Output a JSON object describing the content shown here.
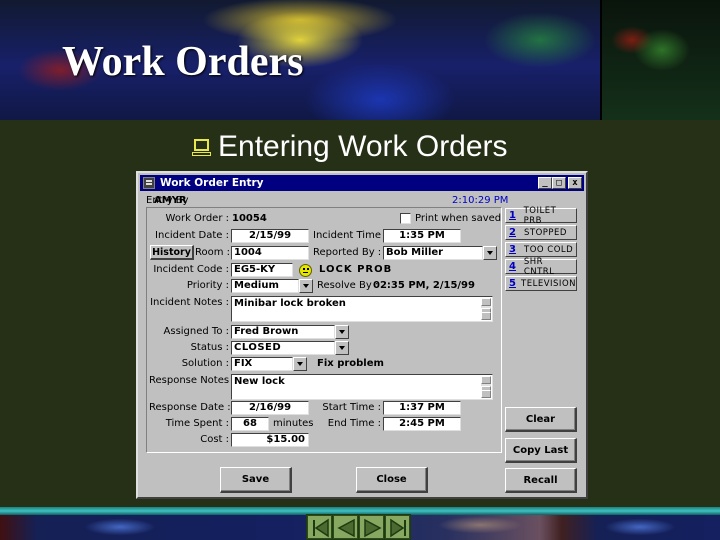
{
  "slide": {
    "title": "Work Orders",
    "bullet_icon": "computer-icon",
    "subtitle": "Entering Work Orders"
  },
  "window": {
    "title": "Work Order Entry",
    "icon": "form-icon",
    "controls": {
      "minimize": "_",
      "maximize": "□",
      "close": "x"
    },
    "entry_by_label": "Entry By",
    "entry_by_value": "AMYR",
    "clock": "2:10:29 PM"
  },
  "form": {
    "work_order": {
      "label": "Work Order :",
      "value": "10054"
    },
    "print_when_saved": {
      "label": "Print when saved",
      "checked": false
    },
    "incident_date": {
      "label": "Incident Date :",
      "value": "2/15/99"
    },
    "incident_time": {
      "label": "Incident Time :",
      "value": "1:35 PM"
    },
    "history_button": "History",
    "room": {
      "label": "Room :",
      "value": "1004"
    },
    "reported_by": {
      "label": "Reported By :",
      "value": "Bob Miller"
    },
    "incident_code": {
      "label": "Incident Code :",
      "value": "EG5-KY",
      "icon": "smiley-icon",
      "description": "LOCK PROB"
    },
    "priority": {
      "label": "Priority :",
      "value": "Medium"
    },
    "resolve_by": {
      "label": "Resolve By :",
      "value": "02:35 PM, 2/15/99"
    },
    "incident_notes": {
      "label": "Incident Notes :",
      "value": "Minibar lock broken"
    },
    "assigned_to": {
      "label": "Assigned To :",
      "value": "Fred Brown"
    },
    "status": {
      "label": "Status :",
      "value": "CLOSED"
    },
    "solution": {
      "label": "Solution :",
      "value": "FIX",
      "description": "Fix problem"
    },
    "response_notes": {
      "label": "Response Notes :",
      "value": "New lock"
    },
    "response_date": {
      "label": "Response Date :",
      "value": "2/16/99"
    },
    "start_time": {
      "label": "Start Time :",
      "value": "1:37 PM"
    },
    "time_spent": {
      "label": "Time Spent :",
      "value": "68",
      "unit": "minutes"
    },
    "end_time": {
      "label": "End Time :",
      "value": "2:45 PM"
    },
    "cost": {
      "label": "Cost :",
      "value": "$15.00"
    }
  },
  "quick_codes": [
    {
      "num": "1",
      "label": "TOILET PRB"
    },
    {
      "num": "2",
      "label": "STOPPED"
    },
    {
      "num": "3",
      "label": "TOO COLD"
    },
    {
      "num": "4",
      "label": "SHR CNTRL"
    },
    {
      "num": "5",
      "label": "TELEVISION"
    }
  ],
  "buttons": {
    "clear": "Clear",
    "copy_last": "Copy Last",
    "recall": "Recall",
    "save": "Save",
    "close": "Close"
  },
  "nav": [
    {
      "name": "first-slide-button",
      "icon": "first-icon"
    },
    {
      "name": "previous-slide-button",
      "icon": "previous-icon"
    },
    {
      "name": "next-slide-button",
      "icon": "next-icon"
    },
    {
      "name": "last-slide-button",
      "icon": "last-icon"
    }
  ],
  "colors": {
    "slide_background": "#253016",
    "titlebar": "#000080",
    "window_face": "#c0c0c0",
    "clock_text": "#0000c0",
    "bullet_icon": "#e8e84a",
    "nav_button": "#86a860"
  }
}
